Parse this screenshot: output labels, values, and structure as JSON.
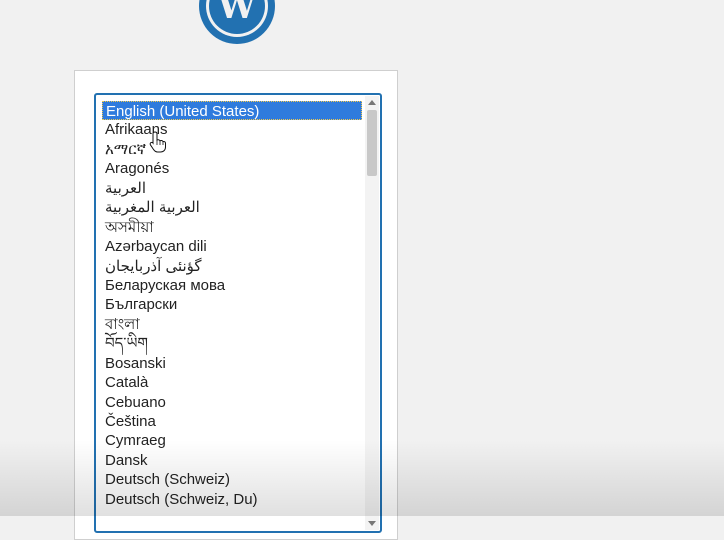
{
  "logo": {
    "icon": "wordpress-logo-icon",
    "color": "#2271b1"
  },
  "language_list": {
    "selected_index": 0,
    "options": [
      "English (United States)",
      "Afrikaans",
      "አማርኛ",
      "Aragonés",
      "العربية",
      "العربية المغربية",
      "অসমীয়া",
      "Azərbaycan dili",
      "گؤنئی آذربایجان",
      "Беларуская мова",
      "Български",
      "বাংলা",
      "བོད་ཡིག",
      "Bosanski",
      "Català",
      "Cebuano",
      "Čeština",
      "Cymraeg",
      "Dansk",
      "Deutsch (Schweiz)",
      "Deutsch (Schweiz, Du)"
    ]
  },
  "colors": {
    "accent": "#2271b1",
    "selected_bg": "#2f7bdd",
    "page_bg": "#f1f1f1"
  }
}
